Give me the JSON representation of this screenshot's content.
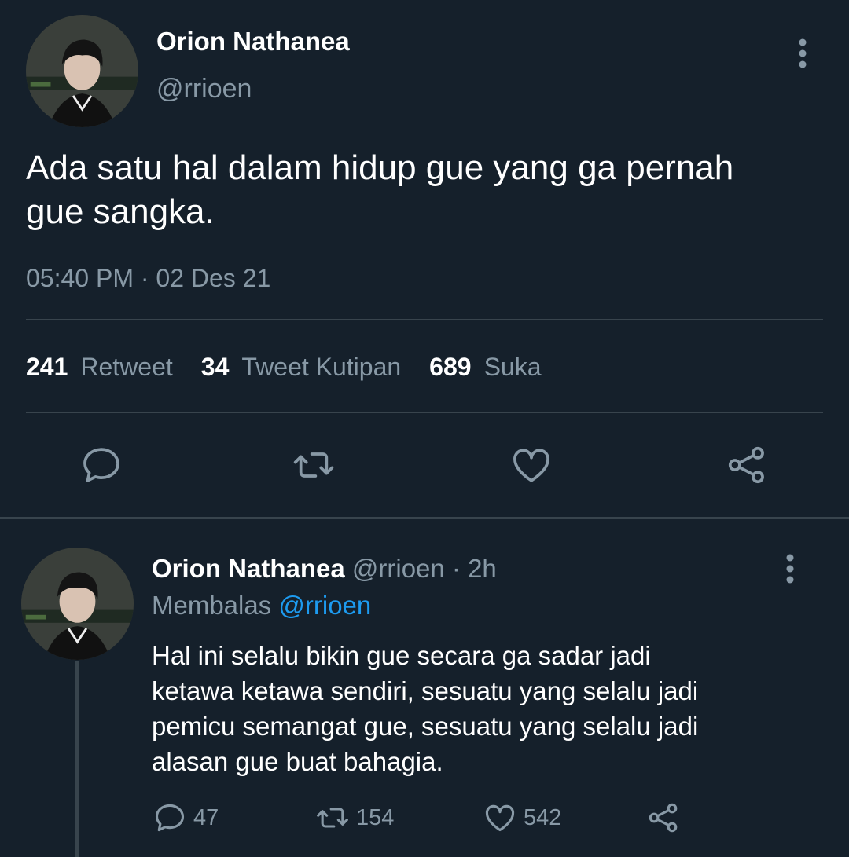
{
  "tweet": {
    "author_name": "Orion Nathanea",
    "author_handle": "@rrioen",
    "text": "Ada satu hal dalam hidup gue yang ga pernah\ngue sangka.",
    "timestamp": "05:40 PM · 02 Des 21",
    "stats": {
      "retweets_count": "241",
      "retweets_label": "Retweet",
      "quotes_count": "34",
      "quotes_label": "Tweet Kutipan",
      "likes_count": "689",
      "likes_label": "Suka"
    },
    "actions": [
      "reply-icon",
      "retweet-icon",
      "like-icon",
      "share-icon"
    ]
  },
  "reply": {
    "author_name": "Orion Nathanea",
    "meta": " @rrioen · 2h",
    "replying_label": "Membalas ",
    "replying_to": "@rrioen",
    "text": "Hal ini selalu bikin gue secara ga sadar jadi\nketawa ketawa sendiri, sesuatu yang selalu jadi\npemicu semangat gue, sesuatu yang selalu jadi\nalasan gue buat bahagia.",
    "reply_count": "47",
    "retweet_count": "154",
    "like_count": "542"
  },
  "colors": {
    "background": "#15202b",
    "secondary_text": "#8899a6",
    "accent": "#1d9bf0",
    "divider": "#38444d"
  }
}
